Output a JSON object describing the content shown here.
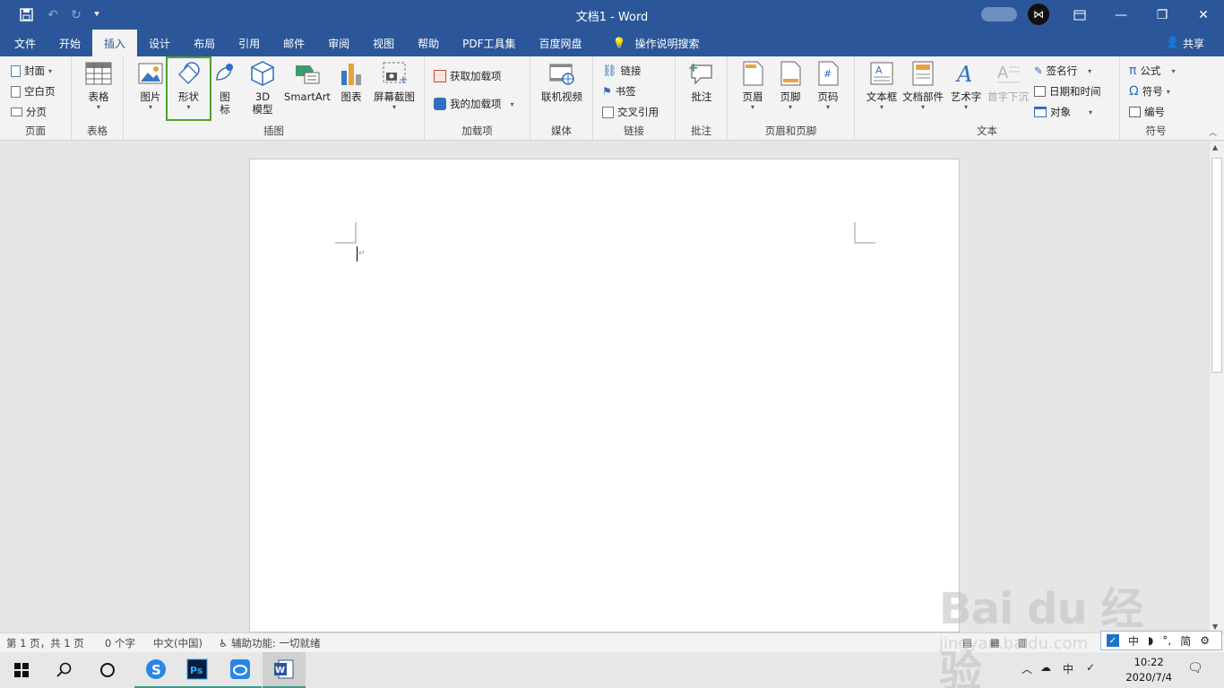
{
  "window": {
    "title": "文档1  -  Word",
    "quick_access": [
      "save-icon",
      "undo-icon",
      "redo-icon",
      "customize-icon"
    ]
  },
  "tabs": [
    "文件",
    "开始",
    "插入",
    "设计",
    "布局",
    "引用",
    "邮件",
    "审阅",
    "视图",
    "帮助",
    "PDF工具集",
    "百度网盘"
  ],
  "active_tab": "插入",
  "tell_me": "操作说明搜索",
  "share": "共享",
  "ribbon": {
    "pages": {
      "label": "页面",
      "cover": "封面",
      "blank": "空白页",
      "break": "分页"
    },
    "tables": {
      "label": "表格",
      "table": "表格"
    },
    "illustrations": {
      "label": "插图",
      "picture": "图片",
      "shapes": "形状",
      "icons1": "图",
      "icons2": "标",
      "model1": "3D",
      "model2": "模型",
      "smartart": "SmartArt",
      "chart": "图表",
      "screenshot": "屏幕截图"
    },
    "addins": {
      "label": "加载项",
      "get": "获取加载项",
      "mine": "我的加载项"
    },
    "media": {
      "label": "媒体",
      "video": "联机视频"
    },
    "links": {
      "label": "链接",
      "link": "链接",
      "bookmark": "书签",
      "xref": "交叉引用"
    },
    "comments": {
      "label": "批注",
      "comment": "批注"
    },
    "headerfooter": {
      "label": "页眉和页脚",
      "header": "页眉",
      "footer": "页脚",
      "pagenum": "页码"
    },
    "text": {
      "label": "文本",
      "textbox": "文本框",
      "parts": "文档部件",
      "wordart": "艺术字",
      "dropcap": "首字下沉",
      "sigline": "签名行",
      "datetime": "日期和时间",
      "object": "对象"
    },
    "symbols": {
      "label": "符号",
      "equation": "公式",
      "symbol": "符号",
      "number": "编号"
    }
  },
  "status": {
    "page": "第 1 页，共 1 页",
    "words": "0 个字",
    "lang": "中文(中国)",
    "accessibility": "辅助功能: 一切就绪"
  },
  "ime": {
    "mode": "中",
    "punct": "°,",
    "script": "简"
  },
  "clock": {
    "time": "10:22",
    "date": "2020/7/4"
  },
  "tray": {
    "lang": "中"
  },
  "watermark": {
    "main": "Bai du 经验",
    "sub": "jingyan.baidu.com"
  },
  "colors": {
    "brand": "#2b579a",
    "highlight": "#4fa12c"
  }
}
